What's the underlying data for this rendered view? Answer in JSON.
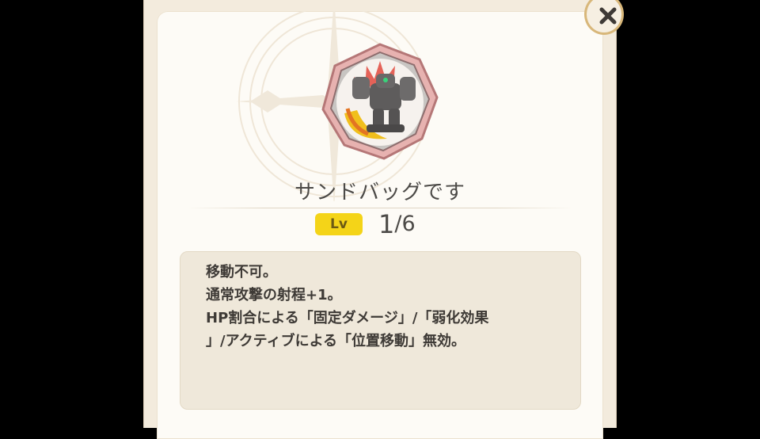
{
  "dialog": {
    "skill_name": "サンドバッグです",
    "level_label": "Lv",
    "level_current": "1",
    "level_max": "/6",
    "description_lines": [
      "移動不可。",
      "通常攻撃の射程+1。",
      "HP割合による「固定ダメージ」/「弱化効果",
      "」/アクティブによる「位置移動」無効。"
    ]
  },
  "icons": {
    "close": "close-icon",
    "skill": "golem-skill-icon"
  },
  "colors": {
    "background": "#000000",
    "panel": "#fdfbf6",
    "level_badge": "#f4d418",
    "badge_frame": "#d88c8c",
    "close_ring": "#d8b77a"
  }
}
